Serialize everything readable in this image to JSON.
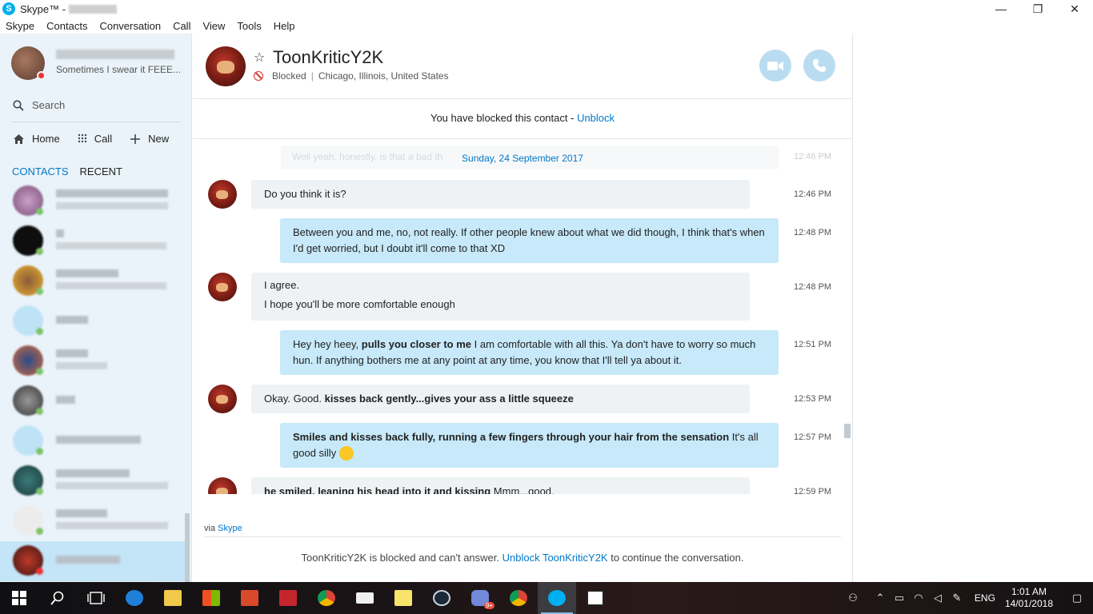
{
  "window": {
    "title": "Skype™ -",
    "controls": {
      "minimize": "—",
      "maximize": "❐",
      "close": "✕"
    }
  },
  "menu": [
    "Skype",
    "Contacts",
    "Conversation",
    "Call",
    "View",
    "Tools",
    "Help"
  ],
  "profile": {
    "mood": "Sometimes I swear it FEEE..."
  },
  "sidebar": {
    "search_label": "Search",
    "nav": [
      {
        "label": "Home",
        "icon": "home-icon"
      },
      {
        "label": "Call",
        "icon": "dialpad-icon"
      },
      {
        "label": "New",
        "icon": "plus-icon"
      }
    ],
    "tabs": {
      "contacts": "CONTACTS",
      "recent": "RECENT"
    }
  },
  "header": {
    "contact_name": "ToonKriticY2K",
    "status": "Blocked",
    "location": "Chicago, Illinois, United States",
    "separator": "|"
  },
  "block_bar": {
    "text": "You have blocked this contact - ",
    "link": "Unblock"
  },
  "chat": {
    "faded_text": "Well yeah, honestly, is that a bad th",
    "faded_time": "12:46 PM",
    "date": "Sunday, 24 September 2017",
    "messages": [
      {
        "dir": "in",
        "time": "12:46 PM",
        "parts": [
          [
            "Do you think it is?"
          ]
        ]
      },
      {
        "dir": "out",
        "time": "12:48 PM",
        "parts": [
          [
            "Between you and me, no, not really. If other people knew about what we did though, I think that's when I'd get worried, but I doubt it'll come to that XD"
          ]
        ]
      },
      {
        "dir": "in",
        "time": "12:48 PM",
        "parts": [
          [
            "I agree."
          ],
          [
            "I hope you'll be more comfortable enough"
          ]
        ]
      },
      {
        "dir": "out",
        "time": "12:51 PM",
        "pre": "Hey hey heey, ",
        "bold": "pulls you closer to me",
        "post": " I am comfortable with all this. Ya don't have to worry so much hun. If anything bothers me at any point at any time, you know that I'll tell ya about it."
      },
      {
        "dir": "in",
        "time": "12:53 PM",
        "pre": "Okay. Good. ",
        "bold": "kisses back gently...gives your ass a little squeeze",
        "post": ""
      },
      {
        "dir": "out",
        "time": "12:57 PM",
        "pre": "",
        "bold": "Smiles and kisses back fully, running a few fingers through your hair from the sensation",
        "post": " It's all good silly "
      },
      {
        "dir": "in",
        "time": "12:59 PM",
        "pre": "",
        "bold": "he smiled, leaning his head into it and kissing",
        "post": " Mmm...good."
      }
    ]
  },
  "footer": {
    "via": "via ",
    "via_link": "Skype",
    "blocked_pre": "ToonKriticY2K is blocked and can't answer. ",
    "blocked_link": "Unblock ToonKriticY2K",
    "blocked_post": " to continue the conversation."
  },
  "taskbar": {
    "lang": "ENG",
    "time": "1:01 AM",
    "date": "14/01/2018",
    "badge": "9+"
  },
  "colors": {
    "accent": "#0078ca",
    "sidebar_bg": "#eaf3f9",
    "outgoing_bubble": "#c7e9f9",
    "incoming_bubble": "#eef2f5",
    "blocked_red": "#d9312a"
  }
}
